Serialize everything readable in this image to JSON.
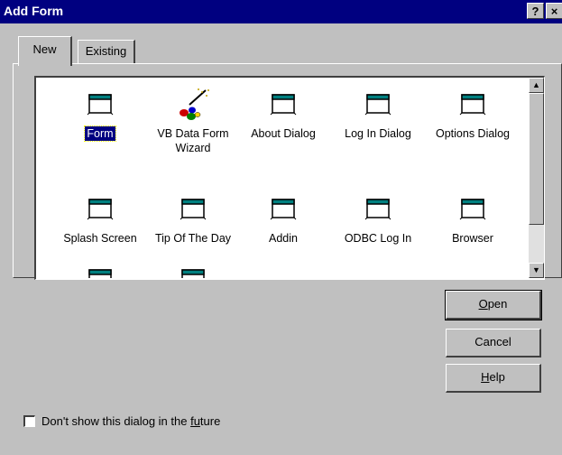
{
  "window": {
    "title": "Add Form",
    "help_button": "?",
    "close_button": "×"
  },
  "tabs": [
    {
      "label": "New",
      "active": true
    },
    {
      "label": "Existing",
      "active": false
    }
  ],
  "items": [
    {
      "label": "Form",
      "icon": "form-icon",
      "selected": true
    },
    {
      "label": "VB Data Form Wizard",
      "icon": "wizard-wand-icon",
      "selected": false
    },
    {
      "label": "About Dialog",
      "icon": "form-icon",
      "selected": false
    },
    {
      "label": "Log In Dialog",
      "icon": "form-icon",
      "selected": false
    },
    {
      "label": "Options Dialog",
      "icon": "form-icon",
      "selected": false
    },
    {
      "label": "Splash Screen",
      "icon": "form-icon",
      "selected": false
    },
    {
      "label": "Tip Of The Day",
      "icon": "form-icon",
      "selected": false
    },
    {
      "label": "Addin",
      "icon": "form-icon",
      "selected": false
    },
    {
      "label": "ODBC Log In",
      "icon": "form-icon",
      "selected": false
    },
    {
      "label": "Browser",
      "icon": "form-icon",
      "selected": false
    }
  ],
  "scrollbar": {
    "up_glyph": "▲",
    "down_glyph": "▼"
  },
  "buttons": {
    "open": {
      "pre": "",
      "accel": "O",
      "post": "pen"
    },
    "cancel": {
      "label": "Cancel"
    },
    "help": {
      "pre": "",
      "accel": "H",
      "post": "elp"
    }
  },
  "checkbox": {
    "pre": "Don't show this dialog in the ",
    "accel": "fu",
    "post": "ture",
    "checked": false
  },
  "colors": {
    "titlebar": "#000080",
    "face": "#c0c0c0",
    "selection": "#000080",
    "form_caption": "#008080"
  }
}
